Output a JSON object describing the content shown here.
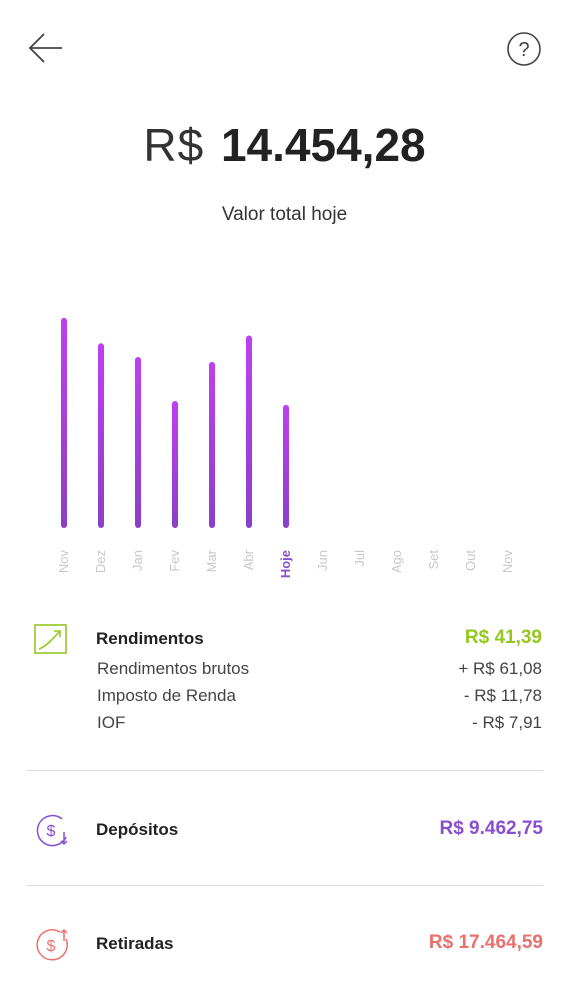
{
  "header": {
    "back_icon": "arrow-left-icon",
    "help_icon": "question-circle-icon"
  },
  "summary": {
    "currency": "R$",
    "total_value": "14.454,28",
    "label": "Valor total hoje"
  },
  "chart_data": {
    "type": "bar",
    "categories": [
      "Nov",
      "Dez",
      "Jan",
      "Fev",
      "Mar",
      "Abr",
      "Hoje",
      "Jun",
      "Jul",
      "Ago",
      "Set",
      "Out",
      "Nov"
    ],
    "values": [
      215,
      189,
      175,
      130,
      170,
      197,
      126,
      null,
      null,
      null,
      null,
      null,
      null
    ],
    "highlight_category": "Hoje",
    "bar_colors": {
      "top": "#c03ff0",
      "bottom": "#8a3fc8"
    },
    "title": "",
    "xlabel": "",
    "ylabel": "",
    "ylim": [
      0,
      220
    ]
  },
  "rendimentos": {
    "icon": "trend-up-icon",
    "title": "Rendimentos",
    "amount": "R$ 41,39",
    "amount_color": "#94c71f",
    "items": [
      {
        "label": "Rendimentos brutos",
        "value": "+ R$ 61,08"
      },
      {
        "label": "Imposto de Renda",
        "value": "- R$ 11,78"
      },
      {
        "label": "IOF",
        "value": "- R$ 7,91"
      }
    ]
  },
  "depositos": {
    "icon": "dollar-deposit-icon",
    "title": "Depósitos",
    "amount": "R$ 9.462,75",
    "amount_color": "#8a4fd0"
  },
  "retiradas": {
    "icon": "dollar-withdraw-icon",
    "title": "Retiradas",
    "amount": "R$ 17.464,59",
    "amount_color": "#e8716d"
  }
}
